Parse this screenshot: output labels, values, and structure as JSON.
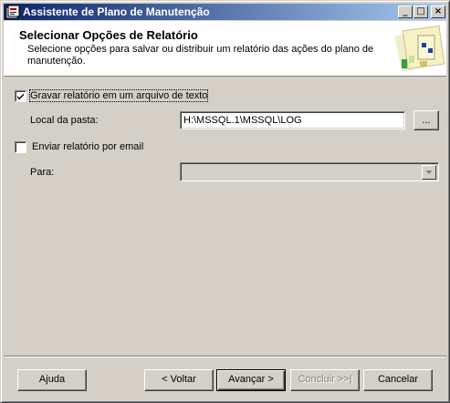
{
  "window": {
    "title": "Assistente de Plano de Manutenção",
    "controls": {
      "minimize": "_",
      "maximize": "□",
      "close": "×"
    }
  },
  "header": {
    "title": "Selecionar Opções de Relatório",
    "subtitle": "Selecione opções para salvar ou distribuir um relatório das ações do plano de manutenção."
  },
  "options": {
    "write_report": {
      "label": "Gravar relatório em um arquivo de texto",
      "checked": true
    },
    "folder": {
      "label": "Local da pasta:",
      "value": "H:\\MSSQL.1\\MSSQL\\LOG",
      "browse_label": "..."
    },
    "email_report": {
      "label": "Enviar relatório por email",
      "checked": false
    },
    "to": {
      "label": "Para:",
      "value": ""
    }
  },
  "buttons": {
    "help": "Ajuda",
    "back": "< Voltar",
    "next": "Avançar >",
    "finish": "Concluir >>|",
    "cancel": "Cancelar"
  },
  "colors": {
    "titlebar_start": "#0a246a",
    "titlebar_end": "#a6caf0",
    "face": "#d4d0c8"
  }
}
